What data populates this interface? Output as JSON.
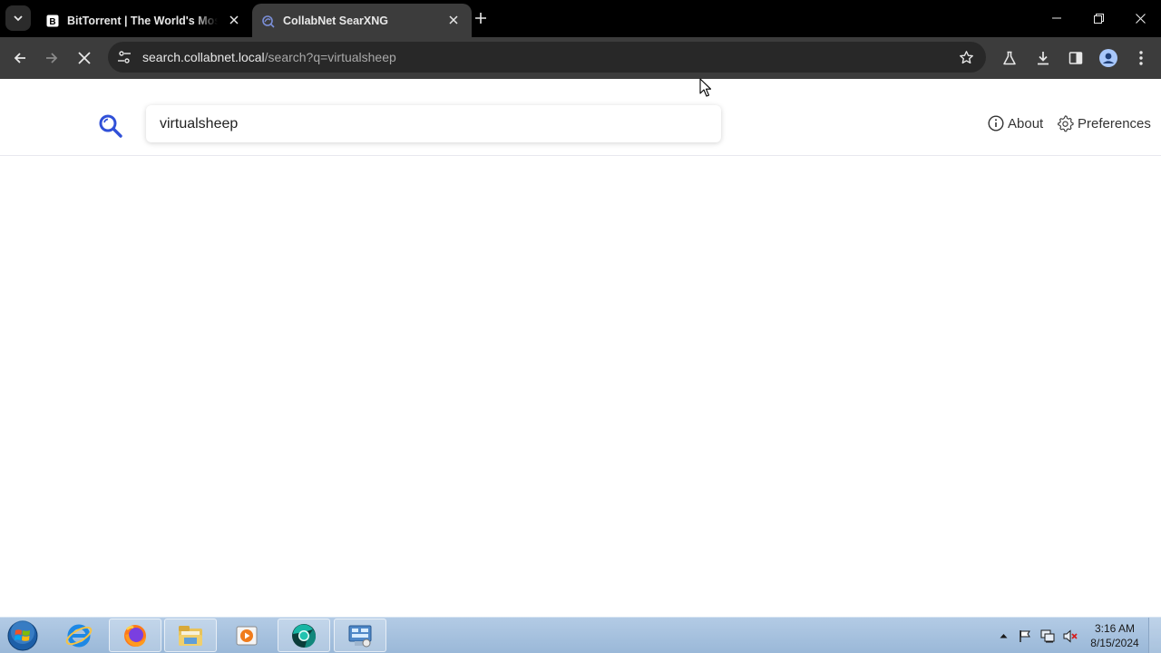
{
  "browser": {
    "tabs": [
      {
        "title": "BitTorrent | The World's Most Popular Torrent Client",
        "favicon": "bittorrent-b-icon",
        "active": false
      },
      {
        "title": "CollabNet SearXNG",
        "favicon": "searxng-icon",
        "active": true
      }
    ],
    "url": {
      "host": "search.collabnet.local",
      "path": "/search?q=virtualsheep"
    }
  },
  "page": {
    "search_value": "virtualsheep",
    "about_label": "About",
    "preferences_label": "Preferences"
  },
  "taskbar": {
    "apps": [
      "internet-explorer-icon",
      "firefox-icon",
      "file-explorer-icon",
      "media-player-icon",
      "chrome-like-icon",
      "control-panel-icon"
    ],
    "time": "3:16 AM",
    "date": "8/15/2024"
  },
  "colors": {
    "accent": "#3050d8",
    "tab_active": "#3c3c3c",
    "taskbar": "#a9c2df"
  }
}
